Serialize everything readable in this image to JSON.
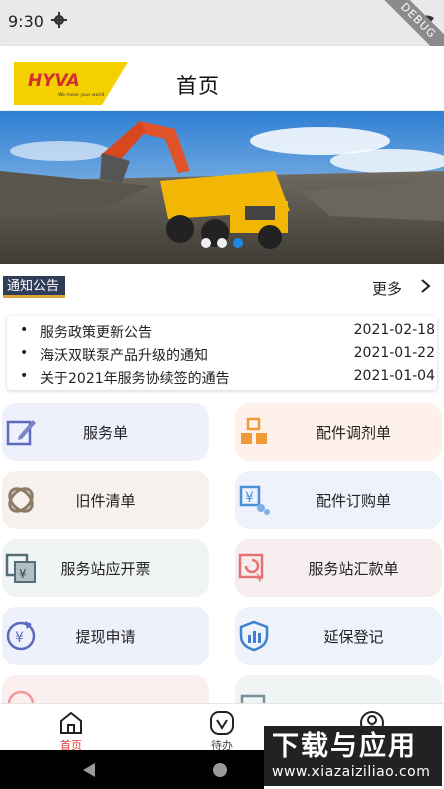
{
  "status_bar": {
    "time": "9:30",
    "debug_badge": "DEBUG"
  },
  "header": {
    "logo_text": "HYVA",
    "logo_tagline": "We move your world",
    "title": "首页"
  },
  "banner": {
    "slide_count": 3,
    "active_slide": 2
  },
  "notice": {
    "tag": "通知公告",
    "more_label": "更多",
    "items": [
      {
        "bullet": "•",
        "title": "服务政策更新公告",
        "date": "2021-02-18"
      },
      {
        "bullet": "•",
        "title": "海沃双联泵产品升级的通知",
        "date": "2021-01-22"
      },
      {
        "bullet": "•",
        "title": "关于2021年服务协续签的通告",
        "date": "2021-01-04"
      }
    ]
  },
  "menu": [
    {
      "label": "服务单",
      "icon": "edit-icon"
    },
    {
      "label": "配件调剂单",
      "icon": "boxes-icon"
    },
    {
      "label": "旧件清单",
      "icon": "rings-icon"
    },
    {
      "label": "配件订购单",
      "icon": "yen-order-icon"
    },
    {
      "label": "服务站应开票",
      "icon": "invoice-icon"
    },
    {
      "label": "服务站汇款单",
      "icon": "remittance-icon"
    },
    {
      "label": "提现申请",
      "icon": "withdraw-icon"
    },
    {
      "label": "延保登记",
      "icon": "shield-chart-icon"
    },
    {
      "label": "",
      "icon": "partial-icon"
    },
    {
      "label": "",
      "icon": "partial-icon"
    }
  ],
  "bottom_nav": [
    {
      "label": "首页",
      "icon": "home-icon",
      "active": true
    },
    {
      "label": "待办",
      "icon": "todo-icon",
      "active": false
    },
    {
      "label": "",
      "icon": "user-icon",
      "active": false
    }
  ],
  "watermark": {
    "title": "下载与应用",
    "url": "www.xiazaiziliao.com"
  },
  "colors": {
    "accent_red": "#e53935",
    "accent_blue": "#1e88e5",
    "notice_tag_bg": "#2f3d59",
    "logo_yellow": "#f5d000"
  }
}
